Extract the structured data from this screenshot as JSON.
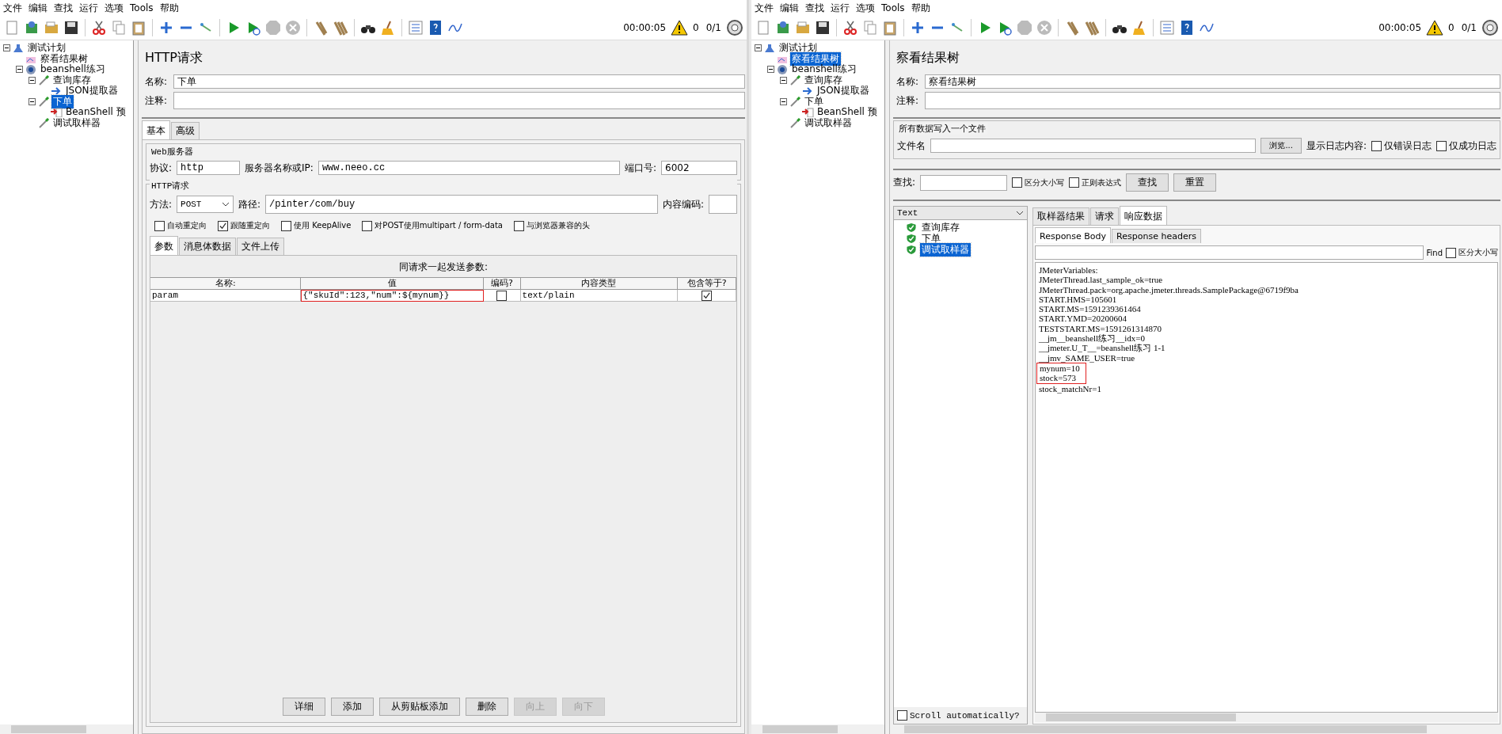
{
  "windows": [
    {
      "menu": [
        "文件",
        "编辑",
        "查找",
        "运行",
        "选项",
        "Tools",
        "帮助"
      ],
      "timer": "00:00:05",
      "warning_count": "0",
      "thread_count": "0/1",
      "tree": [
        {
          "label": "测试计划",
          "kind": "test_plan",
          "selected": false,
          "children": [
            {
              "label": "察看结果树",
              "kind": "listener",
              "selected": false
            },
            {
              "label": "beanshell练习",
              "kind": "thread_group",
              "selected": false,
              "children": [
                {
                  "label": "查询库存",
                  "kind": "sampler",
                  "selected": false,
                  "children": [
                    {
                      "label": "JSON提取器",
                      "kind": "extractor",
                      "selected": false
                    }
                  ]
                },
                {
                  "label": "下单",
                  "kind": "sampler",
                  "selected": true,
                  "children": [
                    {
                      "label": "BeanShell 预",
                      "kind": "preprocessor",
                      "selected": false
                    }
                  ]
                },
                {
                  "label": "调试取样器",
                  "kind": "sampler",
                  "selected": false
                }
              ]
            }
          ]
        }
      ],
      "panel": {
        "kind": "http_request",
        "title": "HTTP请求",
        "name_label": "名称:",
        "name": "下单",
        "comment_label": "注释:",
        "tabs": [
          {
            "label": "基本",
            "selected": true
          },
          {
            "label": "高级",
            "selected": false
          }
        ],
        "web_server": {
          "legend": "Web服务器",
          "protocol_label": "协议:",
          "protocol": "http",
          "server_label": "服务器名称或IP:",
          "server": "www.neeo.cc",
          "port_label": "端口号:",
          "port": "6002"
        },
        "http": {
          "legend": "HTTP请求",
          "method_label": "方法:",
          "method": "POST",
          "path_label": "路径:",
          "path": "/pinter/com/buy",
          "encoding_label": "内容编码:"
        },
        "options": [
          {
            "label": "自动重定向",
            "checked": false
          },
          {
            "label": "跟随重定向",
            "checked": true
          },
          {
            "label": "使用 KeepAlive",
            "checked": false
          },
          {
            "label": "对POST使用multipart / form-data",
            "checked": false
          },
          {
            "label": "与浏览器兼容的头",
            "checked": false
          }
        ],
        "subtabs": [
          {
            "label": "参数",
            "selected": true
          },
          {
            "label": "消息体数据",
            "selected": false
          },
          {
            "label": "文件上传",
            "selected": false
          }
        ],
        "table": {
          "caption": "同请求一起发送参数:",
          "columns": [
            "名称:",
            "值",
            "编码?",
            "内容类型",
            "包含等于?"
          ],
          "rows": [
            {
              "name": "param",
              "value": "{\"skuId\":123,\"num\":${mynum}}",
              "encode": false,
              "content_type": "text/plain",
              "include_equals": true,
              "highlighted": true
            }
          ]
        },
        "buttons": [
          {
            "label": "详细",
            "disabled": false
          },
          {
            "label": "添加",
            "disabled": false
          },
          {
            "label": "从剪贴板添加",
            "disabled": false
          },
          {
            "label": "删除",
            "disabled": false
          },
          {
            "label": "向上",
            "disabled": true
          },
          {
            "label": "向下",
            "disabled": true
          }
        ]
      }
    },
    {
      "menu": [
        "文件",
        "编辑",
        "查找",
        "运行",
        "选项",
        "Tools",
        "帮助"
      ],
      "timer": "00:00:05",
      "warning_count": "0",
      "thread_count": "0/1",
      "tree": [
        {
          "label": "测试计划",
          "kind": "test_plan",
          "selected": false,
          "children": [
            {
              "label": "察看结果树",
              "kind": "listener",
              "selected": true
            },
            {
              "label": "beanshell练习",
              "kind": "thread_group",
              "selected": false,
              "children": [
                {
                  "label": "查询库存",
                  "kind": "sampler",
                  "selected": false,
                  "children": [
                    {
                      "label": "JSON提取器",
                      "kind": "extractor",
                      "selected": false
                    }
                  ]
                },
                {
                  "label": "下单",
                  "kind": "sampler",
                  "selected": false,
                  "children": [
                    {
                      "label": "BeanShell 预",
                      "kind": "preprocessor",
                      "selected": false
                    }
                  ]
                },
                {
                  "label": "调试取样器",
                  "kind": "sampler",
                  "selected": false
                }
              ]
            }
          ]
        }
      ],
      "panel": {
        "kind": "results_tree",
        "title": "察看结果树",
        "name_label": "名称:",
        "name": "察看结果树",
        "comment_label": "注释:",
        "file": {
          "legend": "所有数据写入一个文件",
          "file_label": "文件名",
          "browse": "浏览...",
          "log_label": "显示日志内容:",
          "options": [
            {
              "label": "仅错误日志",
              "checked": false
            },
            {
              "label": "仅成功日志",
              "checked": false
            }
          ]
        },
        "search": {
          "label": "查找:",
          "options": [
            {
              "label": "区分大小写",
              "checked": false
            },
            {
              "label": "正则表达式",
              "checked": false
            }
          ],
          "buttons": [
            "查找",
            "重置"
          ]
        },
        "renderer": "Text",
        "samples": [
          {
            "label": "查询库存",
            "selected": false
          },
          {
            "label": "下单",
            "selected": false
          },
          {
            "label": "调试取样器",
            "selected": true
          }
        ],
        "scroll_auto": {
          "label": "Scroll automatically?",
          "checked": false
        },
        "result_tabs": [
          {
            "label": "取样器结果",
            "selected": false
          },
          {
            "label": "请求",
            "selected": false
          },
          {
            "label": "响应数据",
            "selected": true
          }
        ],
        "body_tabs": [
          {
            "label": "Response Body",
            "selected": true
          },
          {
            "label": "Response headers",
            "selected": false
          }
        ],
        "find": {
          "label": "Find",
          "options": [
            {
              "label": "区分大小写",
              "checked": false
            }
          ]
        },
        "lines": [
          {
            "text": "JMeterVariables:",
            "highlighted": false
          },
          {
            "text": "JMeterThread.last_sample_ok=true",
            "highlighted": false
          },
          {
            "text": "JMeterThread.pack=org.apache.jmeter.threads.SamplePackage@6719f9ba",
            "highlighted": false
          },
          {
            "text": "START.HMS=105601",
            "highlighted": false
          },
          {
            "text": "START.MS=1591239361464",
            "highlighted": false
          },
          {
            "text": "START.YMD=20200604",
            "highlighted": false
          },
          {
            "text": "TESTSTART.MS=1591261314870",
            "highlighted": false
          },
          {
            "text": "__jm__beanshell练习__idx=0",
            "highlighted": false
          },
          {
            "text": "__jmeter.U_T__=beanshell练习 1-1",
            "highlighted": false
          },
          {
            "text": "__jmv_SAME_USER=true",
            "highlighted": false
          },
          {
            "text": "mynum=10",
            "highlighted": true
          },
          {
            "text": "stock=573",
            "highlighted": true
          },
          {
            "text": "stock_matchNr=1",
            "highlighted": false
          }
        ]
      }
    }
  ]
}
